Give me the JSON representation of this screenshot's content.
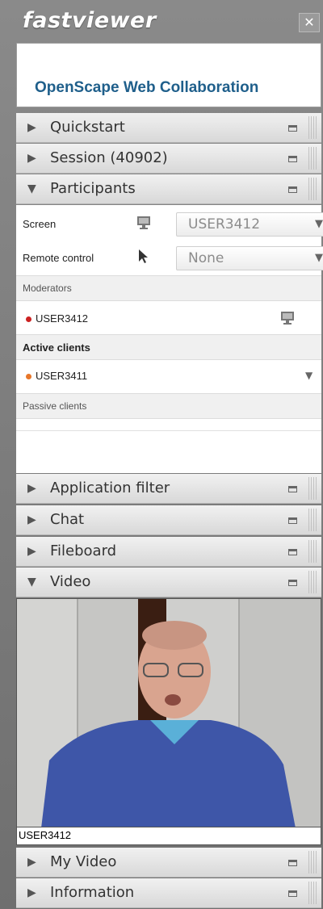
{
  "app": {
    "title": "fastviewer",
    "close_symbol": "✕"
  },
  "banner": {
    "text": "OpenScape Web Collaboration"
  },
  "sections_top": [
    {
      "label": "Quickstart",
      "expanded": false
    },
    {
      "label": "Session (40902)",
      "expanded": false
    },
    {
      "label": "Participants",
      "expanded": true
    }
  ],
  "participants": {
    "screen_label": "Screen",
    "screen_value": "USER3412",
    "remote_label": "Remote control",
    "remote_value": "None",
    "moderators_header": "Moderators",
    "moderator": {
      "name": "USER3412",
      "status_color": "#cc2222"
    },
    "active_header": "Active clients",
    "active_client": {
      "name": "USER3411",
      "status_color": "#e8772a"
    },
    "passive_header": "Passive clients"
  },
  "sections_mid": [
    {
      "label": "Application filter",
      "expanded": false
    },
    {
      "label": "Chat",
      "expanded": false
    },
    {
      "label": "Fileboard",
      "expanded": false
    },
    {
      "label": "Video",
      "expanded": true
    }
  ],
  "video": {
    "caption": "USER3412"
  },
  "sections_bottom": [
    {
      "label": "My Video",
      "expanded": false
    },
    {
      "label": "Information",
      "expanded": false
    }
  ],
  "icons": {
    "monitor": "monitor-icon",
    "cursor": "cursor-icon",
    "expand": "triangle-right-icon",
    "collapse": "triangle-down-icon",
    "minimize": "minimize-icon",
    "grip": "drag-grip-icon"
  }
}
